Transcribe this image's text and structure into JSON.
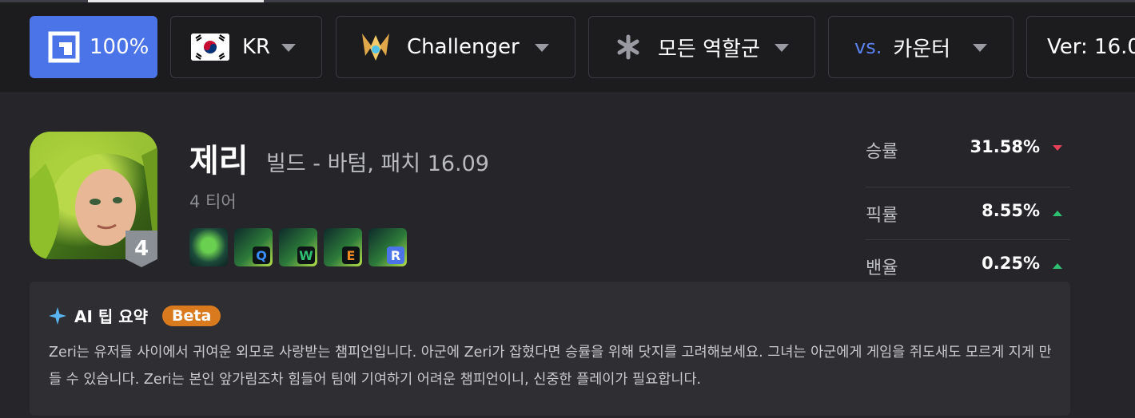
{
  "filters": {
    "percent": "100%",
    "region": "KR",
    "tier": "Challenger",
    "role": "모든 역할군",
    "vs_prefix": "vs.",
    "vs_label": "카운터",
    "version": "Ver: 16.0"
  },
  "champion": {
    "name": "제리",
    "build_subtitle": "빌드 - 바텀, 패치 16.09",
    "tier_badge": "4",
    "tier_text": "4 티어",
    "skills": [
      {
        "key": "",
        "name": "passive"
      },
      {
        "key": "Q",
        "color": "#3a8dff"
      },
      {
        "key": "W",
        "color": "#2fbf71"
      },
      {
        "key": "E",
        "color": "#f08a24"
      },
      {
        "key": "R",
        "color": "#ffffff",
        "bg": "#4b74e8"
      }
    ]
  },
  "stats": [
    {
      "label": "승률",
      "value": "31.58%",
      "trend": "down"
    },
    {
      "label": "픽률",
      "value": "8.55%",
      "trend": "up"
    },
    {
      "label": "밴율",
      "value": "0.25%",
      "trend": "up"
    }
  ],
  "ai_tip": {
    "title": "AI 팁 요약",
    "badge": "Beta",
    "text": "Zeri는 유저들 사이에서 귀여운 외모로 사랑받는 챔피언입니다. 아군에 Zeri가 잡혔다면 승률을 위해 닷지를 고려해보세요. 그녀는 아군에게 게임을 쥐도새도 모르게 지게 만들 수 있습니다. Zeri는 본인 앞가림조차 힘들어 팀에 기여하기 어려운 챔피언이니, 신중한 플레이가 필요합니다."
  },
  "colors": {
    "accent": "#4b74e8",
    "down": "#e84057",
    "up": "#2fbf71",
    "beta": "#d97a1f"
  }
}
